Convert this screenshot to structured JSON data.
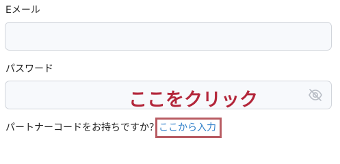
{
  "form": {
    "email_label": "Eメール",
    "email_value": "",
    "password_label": "パスワード",
    "password_value": "",
    "password_toggle_icon": "eye-slash-icon"
  },
  "partner": {
    "question": "パートナーコードをお持ちですか？",
    "link_text": "ここから入力",
    "link_color": "#2f7fc9"
  },
  "annotation": {
    "text": "ここをクリック",
    "color": "#b3263a",
    "highlight_color": "#b85c63"
  }
}
